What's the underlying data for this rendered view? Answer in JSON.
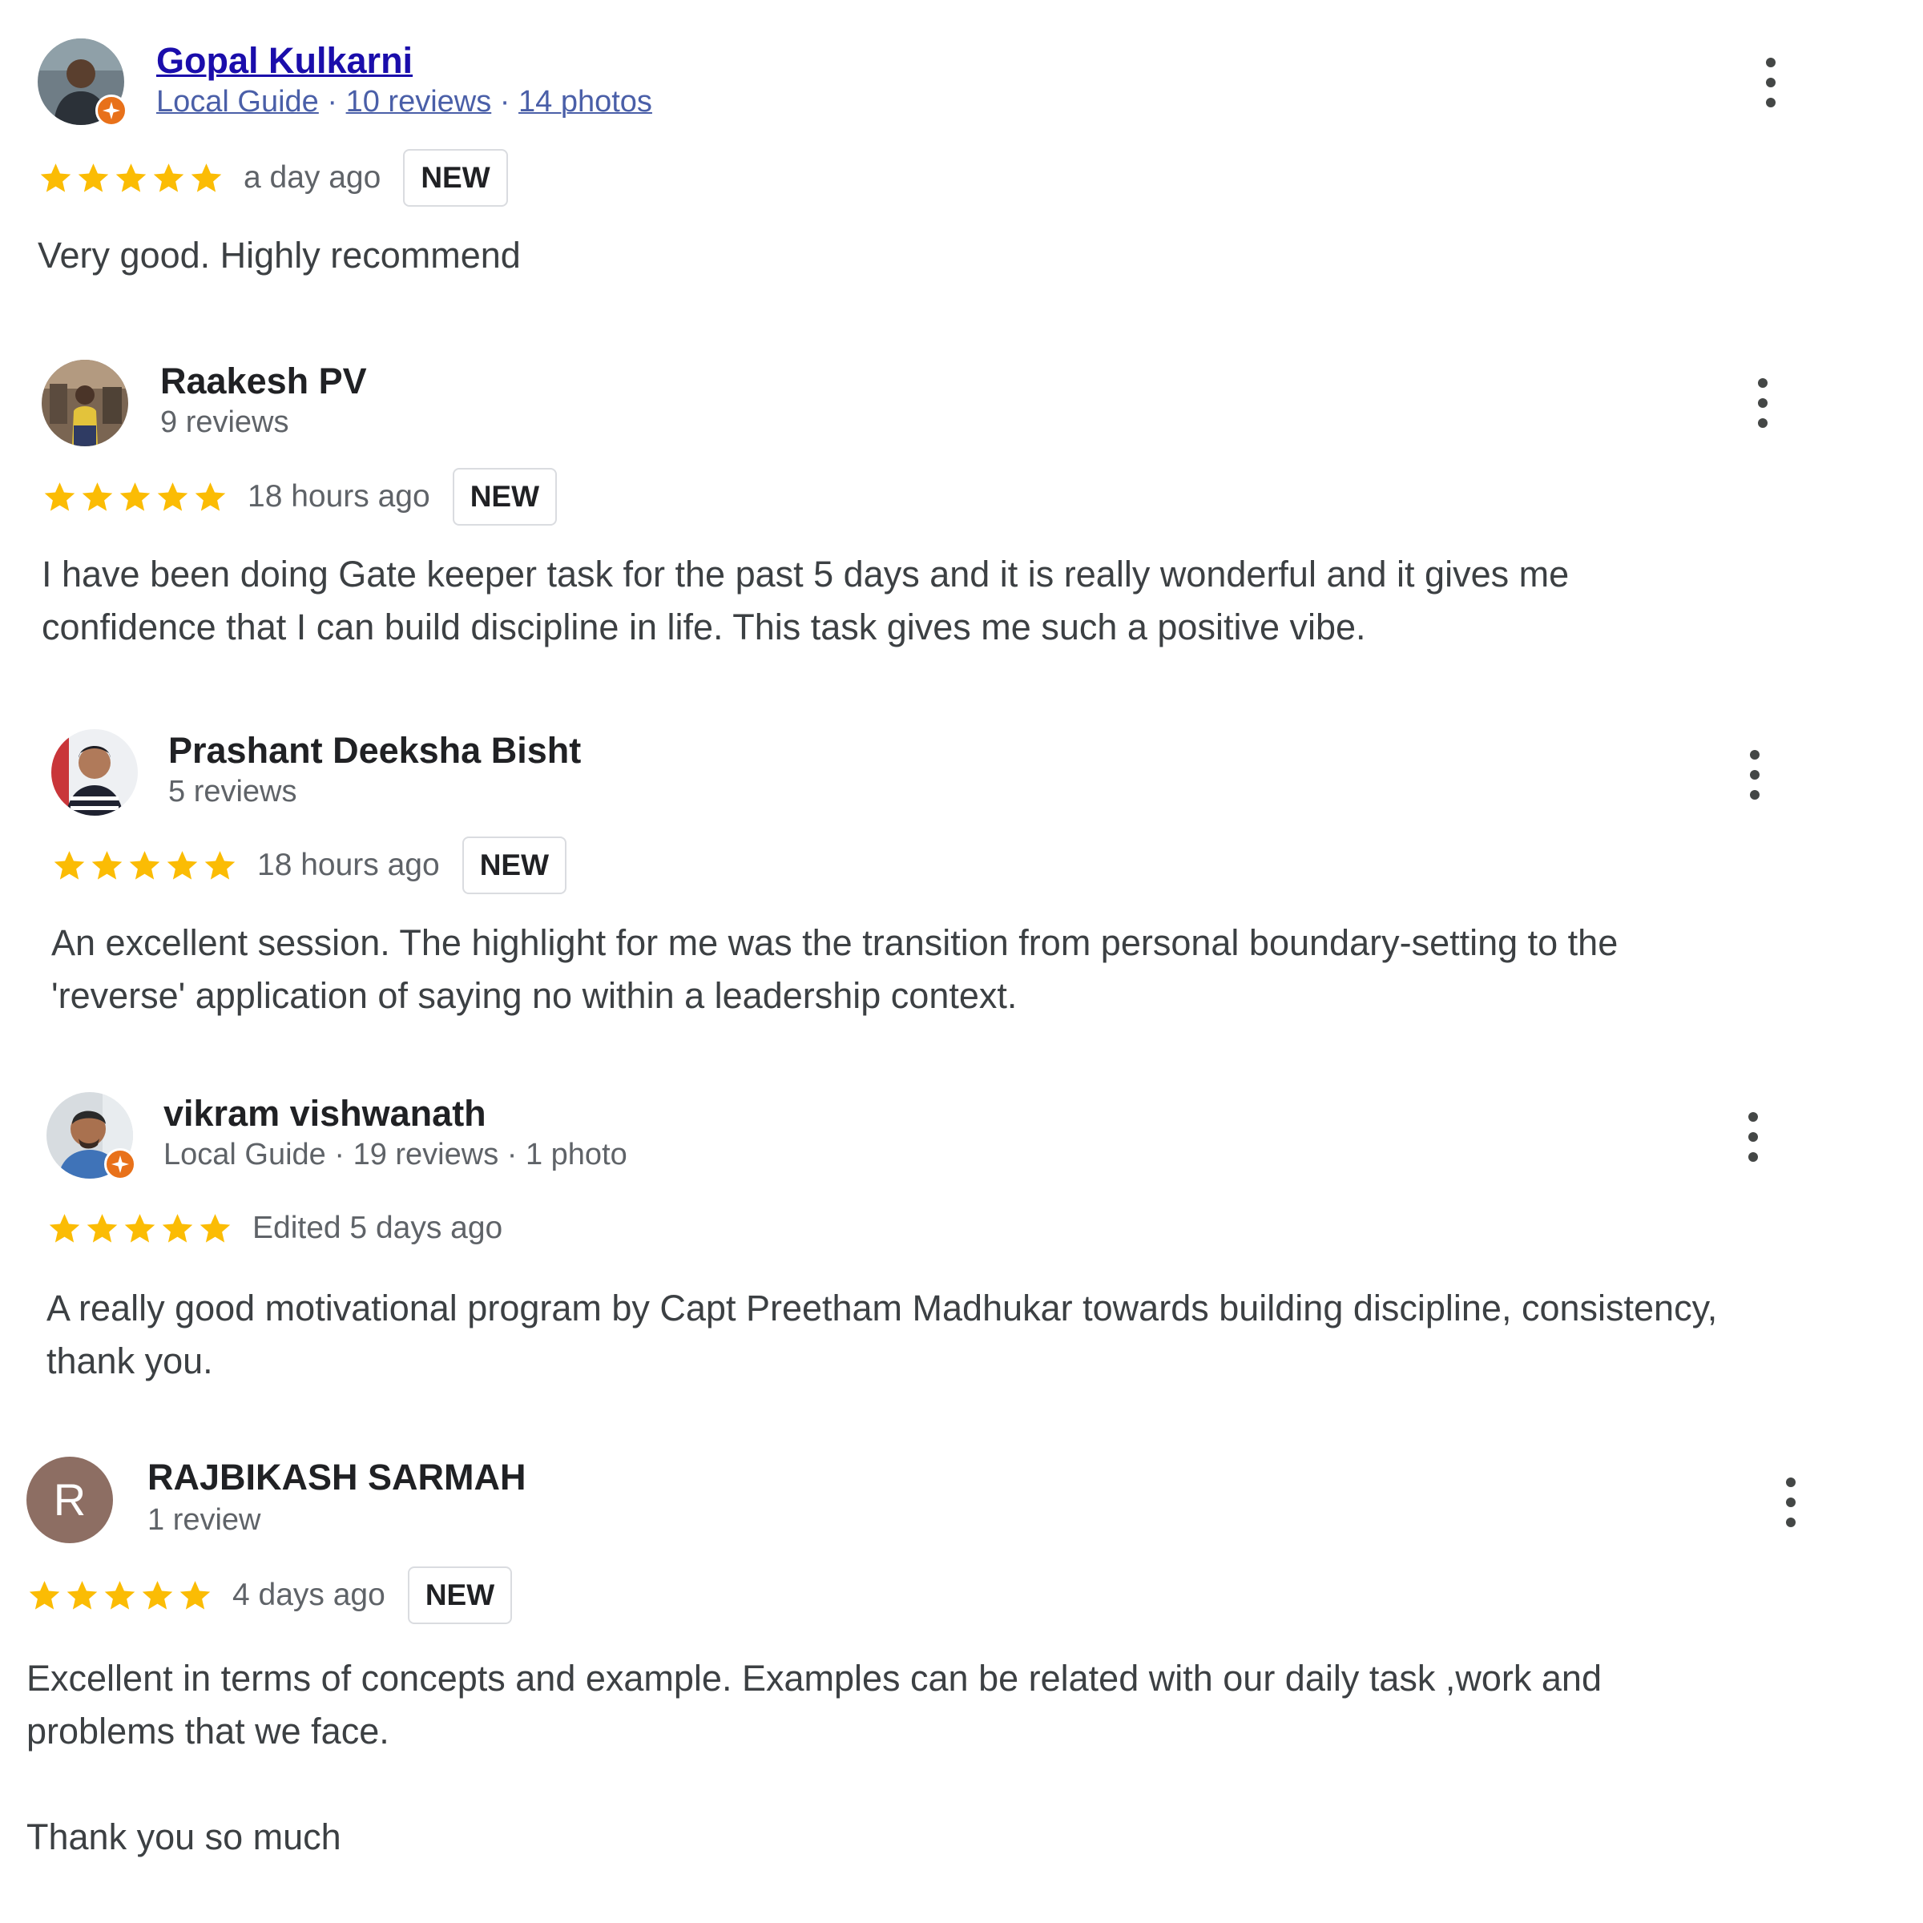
{
  "colors": {
    "star": "#fbbc04",
    "guide_badge": "#e8711a",
    "avatar_letter_bg": "#8d6e63",
    "link_name": "#1a0dab"
  },
  "icons": {
    "more": "more-vert-icon",
    "star": "star-icon",
    "local_guide": "local-guide-badge-icon"
  },
  "reviews": [
    {
      "name": "Gopal Kulkarni",
      "meta_parts": [
        "Local Guide",
        "10 reviews",
        "14 photos"
      ],
      "rating": 5,
      "time": "a day ago",
      "badge": "NEW",
      "text": "Very good. Highly recommend"
    },
    {
      "name": "Raakesh PV",
      "meta": "9 reviews",
      "rating": 5,
      "time": "18 hours ago",
      "badge": "NEW",
      "text": "I have been doing Gate keeper task for the past 5 days and it is really wonderful and it gives me\nconfidence that I can build discipline in life. This task gives me such a positive vibe."
    },
    {
      "name": "Prashant Deeksha Bisht",
      "meta": "5 reviews",
      "rating": 5,
      "time": "18 hours ago",
      "badge": "NEW",
      "text": "An excellent session. The highlight for me was the transition from personal boundary-setting to the\n'reverse' application of saying no within a leadership context."
    },
    {
      "name": "vikram vishwanath",
      "meta": "Local Guide · 19 reviews · 1 photo",
      "rating": 5,
      "time": "Edited 5 days ago",
      "text": "A really good motivational program by Capt Preetham Madhukar towards building discipline, consistency,\nthank you."
    },
    {
      "name": "RAJBIKASH SARMAH",
      "avatar_letter": "R",
      "meta": "1 review",
      "rating": 5,
      "time": "4 days ago",
      "badge": "NEW",
      "text": "Excellent in terms of concepts and example. Examples can be related with our daily task ,work and\nproblems that we face.\n\nThank you so much"
    }
  ]
}
